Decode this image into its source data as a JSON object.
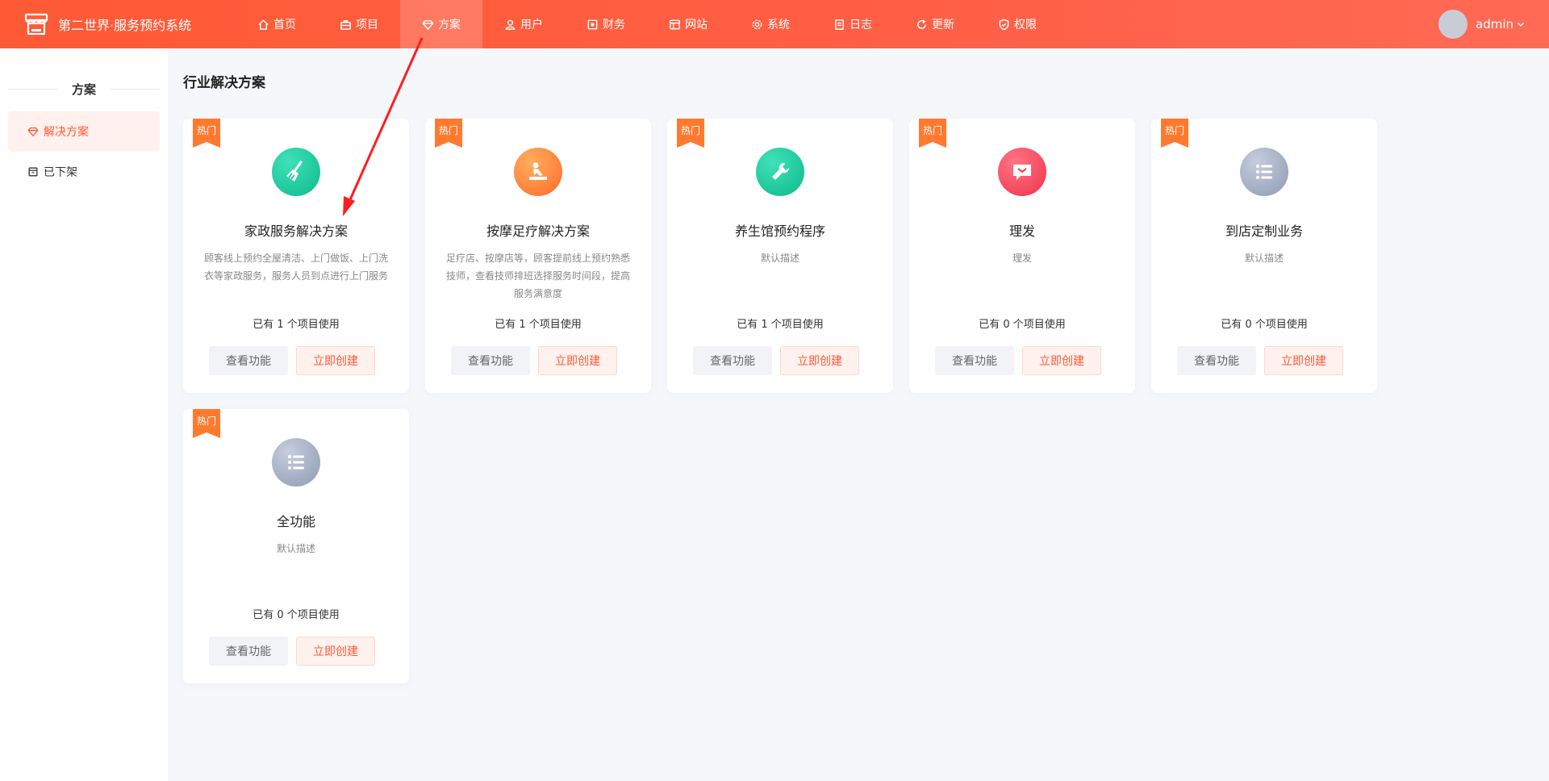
{
  "header": {
    "title": "第二世界·服务预约系统",
    "nav": [
      {
        "label": "首页",
        "icon": "home-icon"
      },
      {
        "label": "项目",
        "icon": "briefcase-icon"
      },
      {
        "label": "方案",
        "icon": "diamond-icon",
        "active": true
      },
      {
        "label": "用户",
        "icon": "users-icon"
      },
      {
        "label": "财务",
        "icon": "finance-icon"
      },
      {
        "label": "网站",
        "icon": "website-icon"
      },
      {
        "label": "系统",
        "icon": "gear-icon"
      },
      {
        "label": "日志",
        "icon": "log-icon"
      },
      {
        "label": "更新",
        "icon": "refresh-icon"
      },
      {
        "label": "权限",
        "icon": "shield-icon"
      }
    ],
    "user": "admin"
  },
  "sidebar": {
    "title": "方案",
    "items": [
      {
        "label": "解决方案",
        "icon": "diamond-icon",
        "active": true
      },
      {
        "label": "已下架",
        "icon": "archive-icon"
      }
    ]
  },
  "main": {
    "title": "行业解决方案",
    "badge": "热门",
    "view_label": "查看功能",
    "create_label": "立即创建",
    "cards": [
      {
        "name": "家政服务解决方案",
        "desc": "顾客线上预约全屋清洁、上门做饭、上门洗衣等家政服务，服务人员到点进行上门服务",
        "usage": "已有 1 个项目使用",
        "icon": "broom-icon",
        "color": "#1dcca0"
      },
      {
        "name": "按摩足疗解决方案",
        "desc": "足疗店、按摩店等，顾客提前线上预约熟悉技师，查看技师排班选择服务时间段，提高服务满意度",
        "usage": "已有 1 个项目使用",
        "icon": "massage-icon",
        "color": "#ff8a3d"
      },
      {
        "name": "养生馆预约程序",
        "desc": "默认描述",
        "usage": "已有 1 个项目使用",
        "icon": "wrench-icon",
        "color": "#17c9a3"
      },
      {
        "name": "理发",
        "desc": "理发",
        "usage": "已有 0 个项目使用",
        "icon": "chat-icon",
        "color": "#ff4a5e"
      },
      {
        "name": "到店定制业务",
        "desc": "默认描述",
        "usage": "已有 0 个项目使用",
        "icon": "list-icon",
        "color": "#a3adc2"
      },
      {
        "name": "全功能",
        "desc": "默认描述",
        "usage": "已有 0 个项目使用",
        "icon": "list-icon",
        "color": "#a3adc2"
      }
    ]
  }
}
